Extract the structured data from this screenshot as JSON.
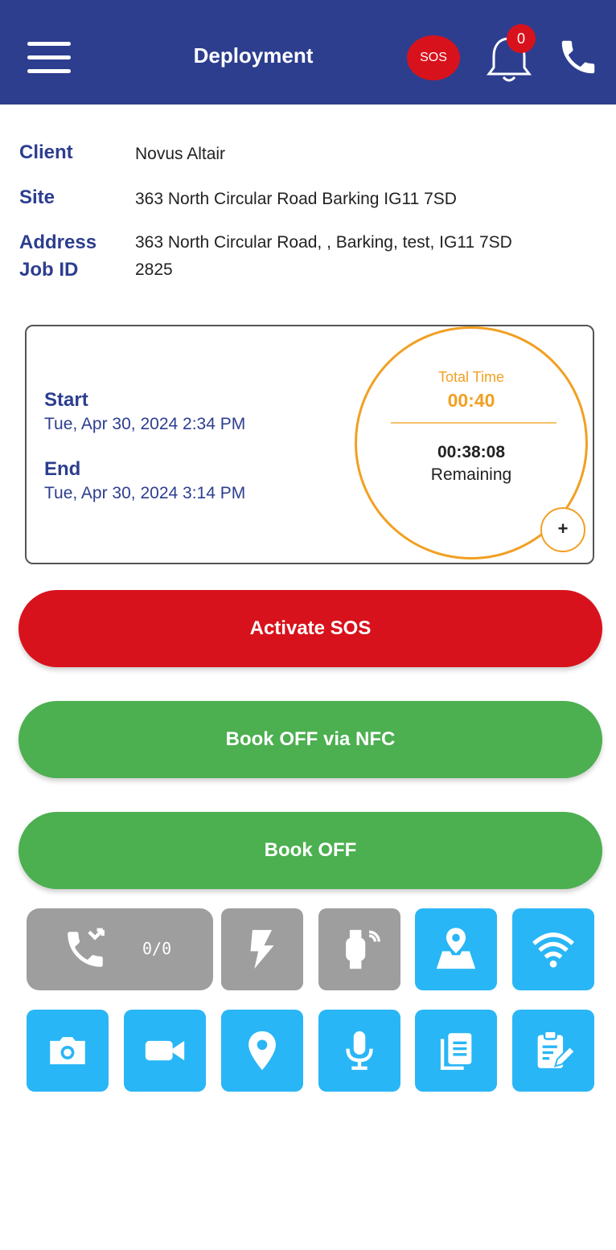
{
  "appbar": {
    "title": "Deployment",
    "sos_label": "SOS",
    "notification_count": "0"
  },
  "job": {
    "client_label": "Client",
    "client_value": "Novus Altair",
    "site_label": "Site",
    "site_value": "363 North Circular Road Barking IG11 7SD",
    "address_label": "Address",
    "address_value": "363 North Circular Road, , Barking, test, IG11 7SD",
    "jobid_label": "Job ID",
    "jobid_value": "2825"
  },
  "timecard": {
    "start_label": "Start",
    "start_value": "Tue, Apr 30, 2024 2:34 PM",
    "end_label": "End",
    "end_value": "Tue, Apr 30, 2024 3:14 PM",
    "total_label": "Total Time",
    "total_value": "00:40",
    "remaining_value": "00:38:08",
    "remaining_label": "Remaining",
    "add_label": "+"
  },
  "actions": {
    "sos": "Activate SOS",
    "book_off_nfc": "Book OFF via NFC",
    "book_off": "Book OFF"
  },
  "tools": {
    "calls_count": "0/0",
    "row1": [
      "missed-call-icon",
      "flash-icon",
      "smartwatch-icon",
      "map-location-icon",
      "wifi-icon"
    ],
    "row2": [
      "camera-icon",
      "video-camera-icon",
      "location-pin-icon",
      "microphone-icon",
      "documents-icon",
      "clipboard-edit-icon"
    ]
  },
  "colors": {
    "primary": "#2d3e8f",
    "danger": "#d8121c",
    "success": "#4caf50",
    "accent": "#f1a023",
    "tile_blue": "#29b6f6",
    "tile_grey": "#9e9e9e"
  }
}
